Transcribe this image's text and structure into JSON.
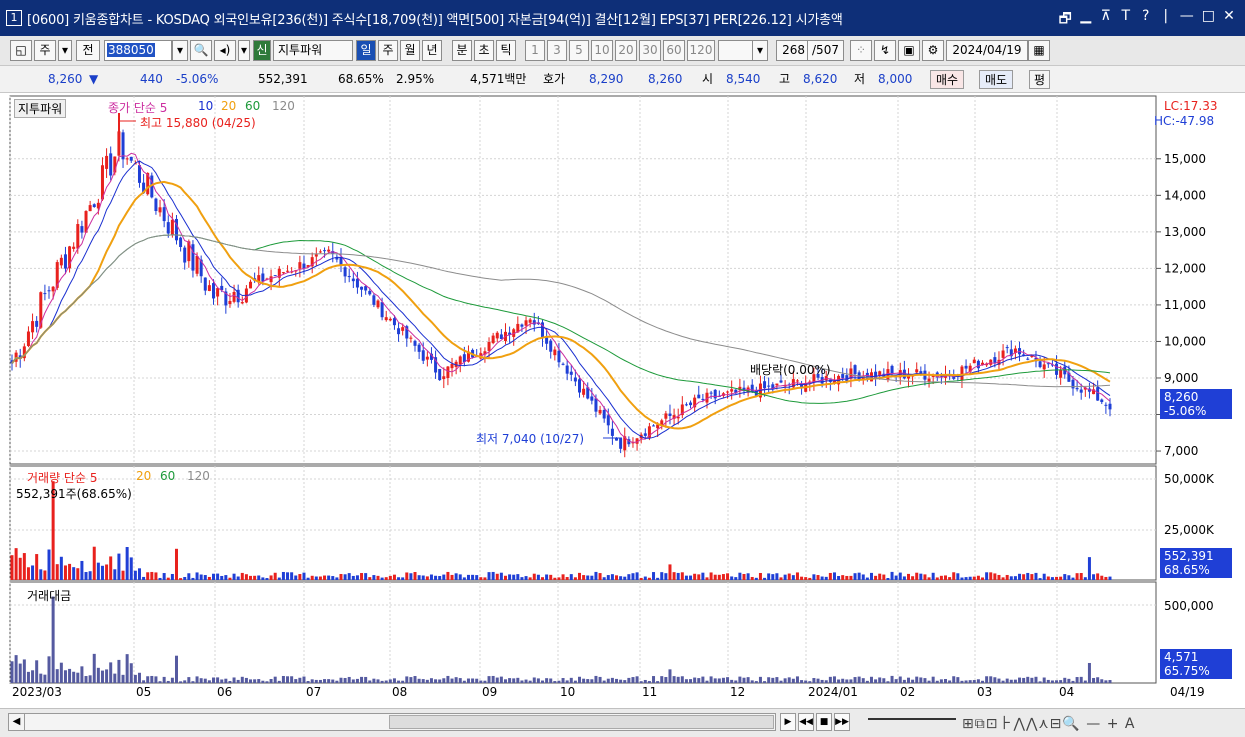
{
  "window": {
    "number": "1",
    "title": "[0600] 키움종합차트 - KOSDAQ 외국인보유[236(천)] 주식수[18,709(천)] 액면[500] 자본금[94(억)] 결산[12월] EPS[37] PER[226.12] 시가총액",
    "controls": [
      "🗗",
      "▁",
      "⊼",
      "T",
      "?",
      "|",
      "—",
      "□",
      "✕"
    ]
  },
  "toolbar": {
    "market": "주",
    "all_label": "전",
    "code": "388050",
    "stock_name": "지투파워",
    "new_badge": "신",
    "periods": [
      "일",
      "주",
      "월",
      "년",
      "분",
      "초",
      "틱"
    ],
    "active_period": "일",
    "intervals": [
      "1",
      "3",
      "5",
      "10",
      "20",
      "30",
      "60",
      "120"
    ],
    "count": "268",
    "total": "/507",
    "date": "2024/04/19"
  },
  "quote": {
    "price": "8,260",
    "arrow": "▼",
    "change": "440",
    "change_pct": "-5.06%",
    "volume": "552,391",
    "volume_ratio": "68.65%",
    "turnover": "2.95%",
    "amount": "4,571백만",
    "ask_label": "호가",
    "ask": "8,290",
    "bid": "8,260",
    "open_label": "시",
    "open": "8,540",
    "high_label": "고",
    "high": "8,620",
    "low_label": "저",
    "low": "8,000",
    "buy_button": "매수",
    "sell_button": "매도",
    "eval_button": "평"
  },
  "price_panel": {
    "name_tag": "지투파워",
    "legend_close": "종가 단순 5",
    "ma": [
      "10",
      "20",
      "60",
      "120"
    ],
    "high_note": "최고 15,880 (04/25)",
    "low_note": "최저 7,040 (10/27)",
    "dividend_note": "배당락(0.00%)",
    "lc": "LC:17.33",
    "hc": "HC:-47.98",
    "last_price": "8,260",
    "last_pct": "-5.06%",
    "y_ticks": [
      "15,000",
      "14,000",
      "13,000",
      "12,000",
      "11,000",
      "10,000",
      "9,000",
      "8,000",
      "7,000"
    ]
  },
  "volume_panel": {
    "title": "거래량 단순 5",
    "ma": [
      "20",
      "60",
      "120"
    ],
    "info": "552,391주(68.65%)",
    "y_ticks": [
      "50,000K",
      "25,000K"
    ],
    "last": "552,391",
    "last_pct": "68.65%"
  },
  "amount_panel": {
    "title": "거래대금",
    "y_ticks": [
      "500,000"
    ],
    "last": "4,571",
    "last_pct": "65.75%"
  },
  "x_axis": {
    "labels": [
      "2023/03",
      "05",
      "06",
      "07",
      "08",
      "09",
      "10",
      "11",
      "12",
      "2024/01",
      "02",
      "03",
      "04"
    ],
    "last_label": "04/19"
  },
  "colors": {
    "up": "#e8211d",
    "down": "#1f3fd6",
    "ma5": "#cc2ea0",
    "ma10": "#1a2fd0",
    "ma20": "#f0a010",
    "ma60": "#1d9a3a",
    "ma120": "#8c8c8c",
    "title_bg": "#0e2f78"
  },
  "chart_data": {
    "type": "candlestick",
    "series": [
      {
        "name": "종가",
        "x": [
          "2023/03",
          "2023/04/25",
          "2023/06",
          "2023/07",
          "2023/08",
          "2023/09",
          "2023/10/27",
          "2023/12",
          "2024/02",
          "2024/03",
          "2024/04/19"
        ],
        "values": [
          9300,
          15880,
          11200,
          12300,
          9600,
          10700,
          7040,
          8300,
          9100,
          9400,
          8260
        ]
      }
    ],
    "ylim": [
      6700,
      16500
    ]
  }
}
